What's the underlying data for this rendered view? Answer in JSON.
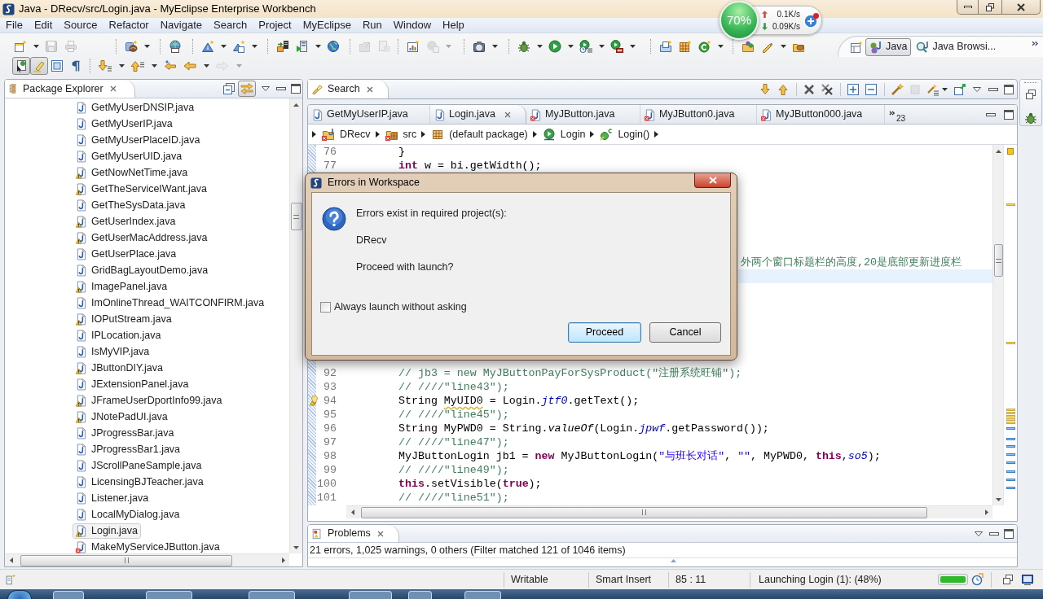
{
  "window": {
    "title": "Java - DRecv/src/Login.java - MyEclipse Enterprise Workbench"
  },
  "net_monitor": {
    "percent": "70%",
    "upload": "0.1K/s",
    "download": "0.09K/s"
  },
  "menu": [
    "File",
    "Edit",
    "Source",
    "Refactor",
    "Navigate",
    "Search",
    "Project",
    "MyEclipse",
    "Run",
    "Window",
    "Help"
  ],
  "toolbar": {
    "rows": [
      [
        [
          {
            "dropdown": true,
            "disabled": false
          },
          {
            "dropdown": false,
            "disabled": true
          },
          {
            "dropdown": false,
            "disabled": true
          }
        ],
        [
          {
            "dropdown": true,
            "disabled": false
          }
        ],
        [
          {
            "dropdown": false,
            "disabled": false
          }
        ],
        [
          {
            "dropdown": true,
            "disabled": false
          },
          {
            "dropdown": true,
            "disabled": false
          }
        ],
        [
          {
            "dropdown": false,
            "disabled": false
          },
          {
            "dropdown": true,
            "disabled": false
          },
          {
            "dropdown": false,
            "disabled": false
          }
        ],
        [
          {
            "dropdown": false,
            "disabled": true
          },
          {
            "dropdown": false,
            "disabled": true
          }
        ],
        [
          {
            "dropdown": false,
            "disabled": false
          },
          {
            "dropdown": true,
            "disabled": true
          }
        ],
        [
          {
            "dropdown": true,
            "disabled": false
          }
        ],
        [
          {
            "dropdown": true,
            "disabled": false
          },
          {
            "dropdown": true,
            "disabled": false
          },
          {
            "dropdown": true,
            "disabled": false
          },
          {
            "dropdown": true,
            "disabled": false
          }
        ],
        [
          {
            "dropdown": false,
            "disabled": false
          },
          {
            "dropdown": false,
            "disabled": false
          },
          {
            "dropdown": true,
            "disabled": false
          }
        ],
        [
          {
            "dropdown": false,
            "disabled": false
          },
          {
            "dropdown": true,
            "disabled": false
          },
          {
            "dropdown": false,
            "disabled": false
          }
        ]
      ],
      [
        [
          {
            "pressed": true
          },
          {
            "pressed": true
          },
          {
            "pressed": false
          },
          {
            "pressed": false
          }
        ],
        [
          {
            "dropdown": true,
            "disabled": false
          },
          {
            "dropdown": true,
            "disabled": false
          },
          {
            "dropdown": false,
            "disabled": false
          },
          {
            "dropdown": true,
            "disabled": false
          },
          {
            "dropdown": true,
            "disabled": true
          }
        ]
      ]
    ]
  },
  "perspectives": [
    {
      "label": "Java",
      "selected": true
    },
    {
      "label": "Java Browsi...",
      "selected": false
    }
  ],
  "package_explorer": {
    "title": "Package Explorer",
    "toolbar": [
      {
        "pressed": false
      },
      {
        "pressed": true
      }
    ],
    "items": [
      {
        "label": "GetMyUserDNSIP.java",
        "kind": "plain",
        "selected": false
      },
      {
        "label": "GetMyUserIP.java",
        "kind": "plain",
        "selected": false
      },
      {
        "label": "GetMyUserPlaceID.java",
        "kind": "plain",
        "selected": false
      },
      {
        "label": "GetMyUserUID.java",
        "kind": "plain",
        "selected": false
      },
      {
        "label": "GetNowNetTime.java",
        "kind": "warning",
        "selected": false
      },
      {
        "label": "GetTheServiceIWant.java",
        "kind": "warning",
        "selected": false
      },
      {
        "label": "GetTheSysData.java",
        "kind": "plain",
        "selected": false
      },
      {
        "label": "GetUserIndex.java",
        "kind": "warning",
        "selected": false
      },
      {
        "label": "GetUserMacAddress.java",
        "kind": "warning",
        "selected": false
      },
      {
        "label": "GetUserPlace.java",
        "kind": "plain",
        "selected": false
      },
      {
        "label": "GridBagLayoutDemo.java",
        "kind": "plain",
        "selected": false
      },
      {
        "label": "ImagePanel.java",
        "kind": "warning",
        "selected": false
      },
      {
        "label": "ImOnlineThread_WAITCONFIRM.java",
        "kind": "plain",
        "selected": false
      },
      {
        "label": "IOPutStream.java",
        "kind": "warning",
        "selected": false
      },
      {
        "label": "IPLocation.java",
        "kind": "plain",
        "selected": false
      },
      {
        "label": "IsMyVIP.java",
        "kind": "plain",
        "selected": false
      },
      {
        "label": "JButtonDIY.java",
        "kind": "warning",
        "selected": false
      },
      {
        "label": "JExtensionPanel.java",
        "kind": "plain",
        "selected": false
      },
      {
        "label": "JFrameUserDportInfo99.java",
        "kind": "warning",
        "selected": false
      },
      {
        "label": "JNotePadUI.java",
        "kind": "warning",
        "selected": false
      },
      {
        "label": "JProgressBar.java",
        "kind": "plain",
        "selected": false
      },
      {
        "label": "JProgressBar1.java",
        "kind": "plain",
        "selected": false
      },
      {
        "label": "JScrollPaneSample.java",
        "kind": "plain",
        "selected": false
      },
      {
        "label": "LicensingBJTeacher.java",
        "kind": "plain",
        "selected": false
      },
      {
        "label": "Listener.java",
        "kind": "plain",
        "selected": false
      },
      {
        "label": "LocalMyDialog.java",
        "kind": "plain",
        "selected": false
      },
      {
        "label": "Login.java",
        "kind": "warning",
        "selected": true
      },
      {
        "label": "MakeMyServiceJButton.java",
        "kind": "error",
        "selected": false
      }
    ]
  },
  "search_view": {
    "title": "Search",
    "toolbar": [
      {
        "disabled": false
      },
      {
        "disabled": false
      },
      {
        "disabled": false
      },
      {
        "disabled": false
      },
      {
        "disabled": false
      },
      {
        "disabled": false
      },
      {
        "disabled": false
      },
      {
        "disabled": true
      },
      {
        "disabled": false,
        "dropdown": true
      },
      {
        "disabled": false
      }
    ]
  },
  "editor": {
    "tabs": [
      {
        "label": "GetMyUserIP.java",
        "kind": "plain",
        "selected": false
      },
      {
        "label": "Login.java",
        "kind": "plain",
        "selected": true
      },
      {
        "label": "MyJButton.java",
        "kind": "error",
        "selected": false
      },
      {
        "label": "MyJButton0.java",
        "kind": "error",
        "selected": false
      },
      {
        "label": "MyJButton000.java",
        "kind": "error",
        "selected": false
      }
    ],
    "more_tabs": "23",
    "breadcrumb": [
      {
        "label": "DRecv",
        "kind": "project",
        "error": true
      },
      {
        "label": "src",
        "kind": "source-folder",
        "error": true
      },
      {
        "label": "(default package)",
        "kind": "package",
        "error": false
      },
      {
        "label": "Login",
        "kind": "class",
        "error": false
      },
      {
        "label": "Login()",
        "kind": "constructor",
        "error": false
      }
    ],
    "lines_above_dialog": [
      {
        "number": "76",
        "warning": false,
        "tokens": [
          {
            "kind": "plain",
            "text": "}"
          }
        ]
      },
      {
        "number": "77",
        "warning": false,
        "tokens": [
          {
            "kind": "keyword",
            "text": "int"
          },
          {
            "kind": "plain",
            "text": " w = bi.getWidth();"
          }
        ]
      }
    ],
    "lines_beside_dialog": [
      {
        "tokens": [
          {
            "kind": "comment",
            "text": "外两个窗口标题栏的高度,20是底部更新进度栏"
          }
        ],
        "current": false
      },
      {
        "current": true
      }
    ],
    "lines_below_dialog": [
      {
        "number": "92",
        "warning": false,
        "tokens": [
          {
            "kind": "comment",
            "text": "// jb3 = new MyJButtonPayForSysProduct(\"注册系统旺铺\");"
          }
        ]
      },
      {
        "number": "93",
        "warning": false,
        "tokens": [
          {
            "kind": "comment",
            "text": "// ////\"line43\");"
          }
        ]
      },
      {
        "number": "94",
        "warning": true,
        "tokens": [
          {
            "kind": "plain",
            "text": "String "
          },
          {
            "kind": "warning",
            "text": "MyUID0"
          },
          {
            "kind": "plain",
            "text": " = Login."
          },
          {
            "kind": "field",
            "text": "jtf0"
          },
          {
            "kind": "plain",
            "text": ".getText();"
          }
        ]
      },
      {
        "number": "95",
        "warning": false,
        "tokens": [
          {
            "kind": "comment",
            "text": "// ////\"line45\");"
          }
        ]
      },
      {
        "number": "96",
        "warning": false,
        "tokens": [
          {
            "kind": "plain",
            "text": "String MyPWD0 = String."
          },
          {
            "kind": "method",
            "text": "valueOf"
          },
          {
            "kind": "plain",
            "text": "(Login."
          },
          {
            "kind": "field",
            "text": "jpwf"
          },
          {
            "kind": "plain",
            "text": ".getPassword());"
          }
        ]
      },
      {
        "number": "97",
        "warning": false,
        "tokens": [
          {
            "kind": "comment",
            "text": "// ////\"line47\");"
          }
        ]
      },
      {
        "number": "98",
        "warning": false,
        "tokens": [
          {
            "kind": "plain",
            "text": "MyJButtonLogin jb1 = "
          },
          {
            "kind": "keyword",
            "text": "new"
          },
          {
            "kind": "plain",
            "text": " MyJButtonLogin("
          },
          {
            "kind": "string",
            "text": "\"与班长对话\""
          },
          {
            "kind": "plain",
            "text": ", "
          },
          {
            "kind": "string",
            "text": "\"\""
          },
          {
            "kind": "plain",
            "text": ", MyPWD0, "
          },
          {
            "kind": "keyword",
            "text": "this"
          },
          {
            "kind": "plain",
            "text": ","
          },
          {
            "kind": "field",
            "text": "so5"
          },
          {
            "kind": "plain",
            "text": ");"
          }
        ]
      },
      {
        "number": "99",
        "warning": false,
        "tokens": [
          {
            "kind": "comment",
            "text": "// ////\"line49\");"
          }
        ]
      },
      {
        "number": "100",
        "warning": false,
        "tokens": [
          {
            "kind": "keyword",
            "text": "this"
          },
          {
            "kind": "plain",
            "text": ".setVisible("
          },
          {
            "kind": "keyword",
            "text": "true"
          },
          {
            "kind": "plain",
            "text": ");"
          }
        ]
      },
      {
        "number": "101",
        "warning": false,
        "tokens": [
          {
            "kind": "comment",
            "text": "// ////\"line51\");"
          }
        ]
      }
    ]
  },
  "dialog": {
    "title": "Errors in Workspace",
    "message": "Errors exist in required project(s):",
    "project": "DRecv",
    "question": "Proceed with launch?",
    "checkbox": {
      "label": "Always launch without asking",
      "checked": false
    },
    "buttons": [
      {
        "label": "Proceed",
        "default": true
      },
      {
        "label": "Cancel",
        "default": false
      }
    ]
  },
  "problems": {
    "title": "Problems",
    "summary": "21 errors, 1,025 warnings, 0 others (Filter matched 121 of 1046 items)"
  },
  "status_bar": {
    "fields": [
      "Writable",
      "Smart Insert",
      "85 : 11"
    ],
    "progress": {
      "label": "Launching Login (1): (48%)",
      "level": 1
    }
  }
}
